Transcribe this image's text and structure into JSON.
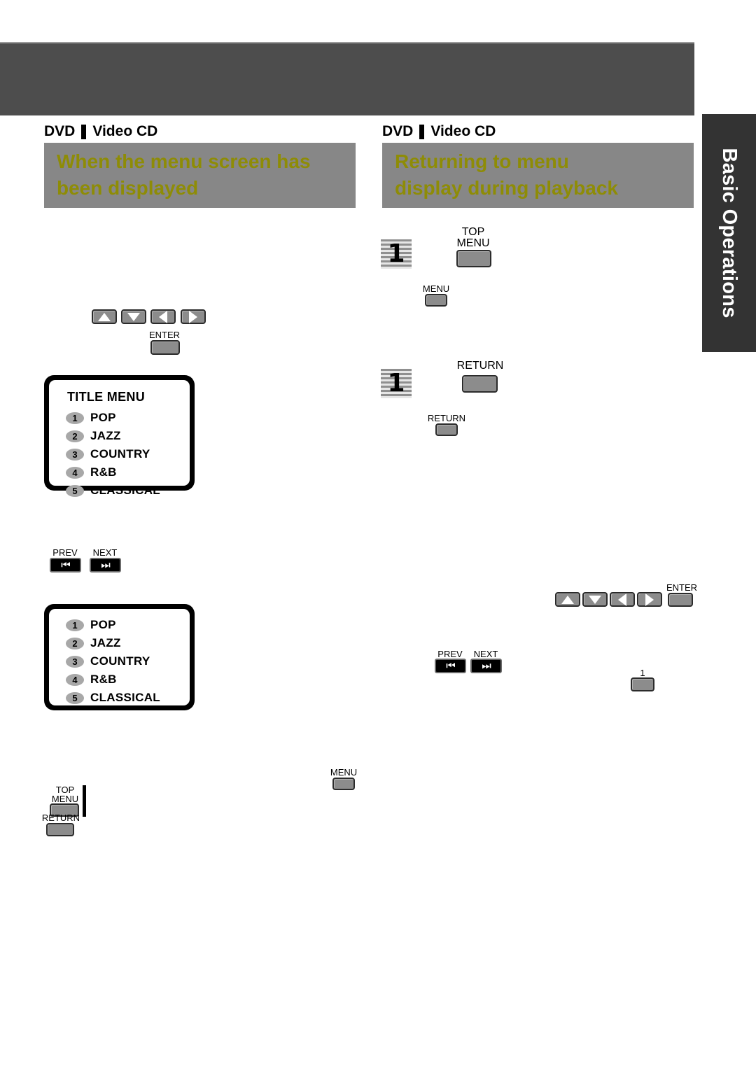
{
  "page": {
    "side_tab_label": "Basic Operations",
    "header_band": ""
  },
  "sections": [
    {
      "media_left": "DVD",
      "media_right": "Video CD",
      "title_line1": "When the menu screen has",
      "title_line2": "been displayed"
    },
    {
      "media_left": "DVD",
      "media_right": "Video CD",
      "title_line1": "Returning to menu",
      "title_line2": "display during playback"
    }
  ],
  "buttons": {
    "up": "",
    "down": "",
    "left": "",
    "right": "",
    "enter": "ENTER",
    "prev": "PREV",
    "next": "NEXT",
    "prev_glyph": "⏮",
    "next_glyph": "⏭",
    "top_menu_line1": "TOP",
    "top_menu_line2": "MENU",
    "menu": "MENU",
    "return": "RETURN",
    "number_one": "1"
  },
  "step_badges": {
    "one": "1"
  },
  "tv_screens": [
    {
      "title": "TITLE MENU",
      "items": [
        {
          "num": "1",
          "label": "POP"
        },
        {
          "num": "2",
          "label": "JAZZ"
        },
        {
          "num": "3",
          "label": "COUNTRY"
        },
        {
          "num": "4",
          "label": "R&B"
        },
        {
          "num": "5",
          "label": "CLASSICAL"
        }
      ]
    },
    {
      "title": "",
      "items": [
        {
          "num": "1",
          "label": "POP"
        },
        {
          "num": "2",
          "label": "JAZZ"
        },
        {
          "num": "3",
          "label": "COUNTRY"
        },
        {
          "num": "4",
          "label": "R&B"
        },
        {
          "num": "5",
          "label": "CLASSICAL"
        }
      ]
    }
  ],
  "colors": {
    "band": "#4d4d4d",
    "tab": "#333333",
    "header_bar": "#878787",
    "header_text": "#8e8c06",
    "button_face": "#8c8c8c"
  }
}
